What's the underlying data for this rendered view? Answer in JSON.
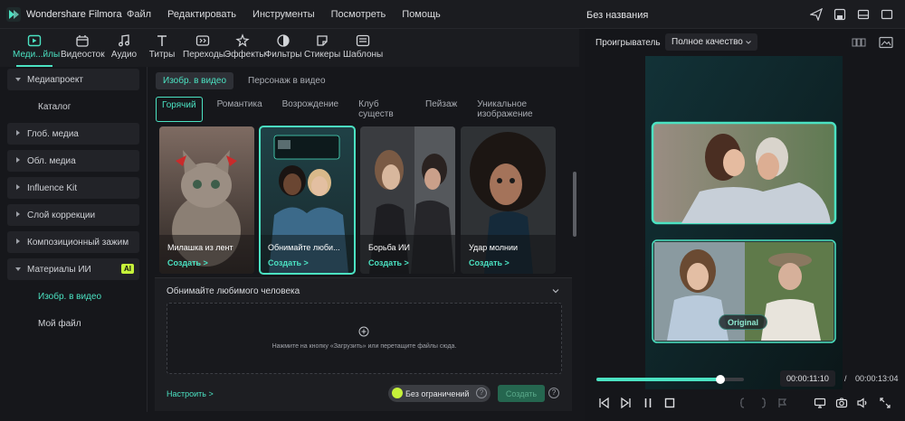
{
  "app": {
    "name": "Wondershare Filmora",
    "project_title": "Без названия"
  },
  "menu": [
    "Файл",
    "Редактировать",
    "Инструменты",
    "Посмотреть",
    "Помощь"
  ],
  "top_icons": [
    "send-icon",
    "save-project-icon",
    "layout-icon",
    "window-icon"
  ],
  "toolbar": [
    {
      "label": "Меди...йлы",
      "icon": "media-icon",
      "active": true
    },
    {
      "label": "Видеосток",
      "icon": "stock-video-icon"
    },
    {
      "label": "Аудио",
      "icon": "audio-icon"
    },
    {
      "label": "Титры",
      "icon": "titles-icon"
    },
    {
      "label": "Переходы",
      "icon": "transitions-icon"
    },
    {
      "label": "Эффекты",
      "icon": "effects-icon"
    },
    {
      "label": "Фильтры",
      "icon": "filters-icon"
    },
    {
      "label": "Стикеры",
      "icon": "stickers-icon"
    },
    {
      "label": "Шаблоны",
      "icon": "templates-icon"
    }
  ],
  "sidebar": {
    "items": [
      {
        "label": "Медиапроект",
        "open": true
      },
      {
        "label": "Каталог",
        "sub": true
      },
      {
        "label": "Глоб. медиа"
      },
      {
        "label": "Обл. медиа"
      },
      {
        "label": "Influence Kit"
      },
      {
        "label": "Слой коррекции"
      },
      {
        "label": "Композиционный зажим"
      },
      {
        "label": "Материалы ИИ",
        "open": true,
        "badge": "AI"
      },
      {
        "label": "Изобр. в видео",
        "sub": true,
        "active": true
      },
      {
        "label": "Мой файл",
        "sub": true
      }
    ]
  },
  "tabs_primary": [
    {
      "label": "Изобр. в видео",
      "selected": true
    },
    {
      "label": "Персонаж в видео"
    }
  ],
  "tabs_categories": [
    {
      "label": "Горячий",
      "selected": true
    },
    {
      "label": "Романтика"
    },
    {
      "label": "Возрождение"
    },
    {
      "label": "Клуб существ"
    },
    {
      "label": "Пейзаж"
    },
    {
      "label": "Уникальное изображение"
    }
  ],
  "cards": [
    {
      "title": "Милашка из лент",
      "action": "Создать >"
    },
    {
      "title": "Обнимайте люби...",
      "action": "Создать >",
      "selected": true
    },
    {
      "title": "Борьба ИИ",
      "action": "Создать >"
    },
    {
      "title": "Удар молнии",
      "action": "Создать >"
    }
  ],
  "panel": {
    "title": "Обнимайте любимого человека",
    "drop_text": "Нажмите на кнопку «Загрузить» или перетащите файлы сюда.",
    "configure": "Настроить >",
    "unlimited": "Без ограничений",
    "create": "Создать"
  },
  "player": {
    "label": "Проигрыватель",
    "quality": "Полное качество",
    "original_label": "Original",
    "progress": 0.84,
    "current_time": "00:00:11:10",
    "separator": "/",
    "total_time": "00:00:13:04",
    "controls": [
      "prev-frame-icon",
      "next-frame-icon",
      "pause-icon",
      "stop-icon"
    ],
    "right_controls": [
      "mark-in-icon",
      "mark-out-icon",
      "clip-marker-icon",
      "monitor-icon",
      "snapshot-icon",
      "volume-icon",
      "fullscreen-icon"
    ]
  },
  "colors": {
    "accent": "#4be2c2",
    "ai_badge": "#c6f23a",
    "bg": "#16171b",
    "panel": "#1d1e22"
  }
}
